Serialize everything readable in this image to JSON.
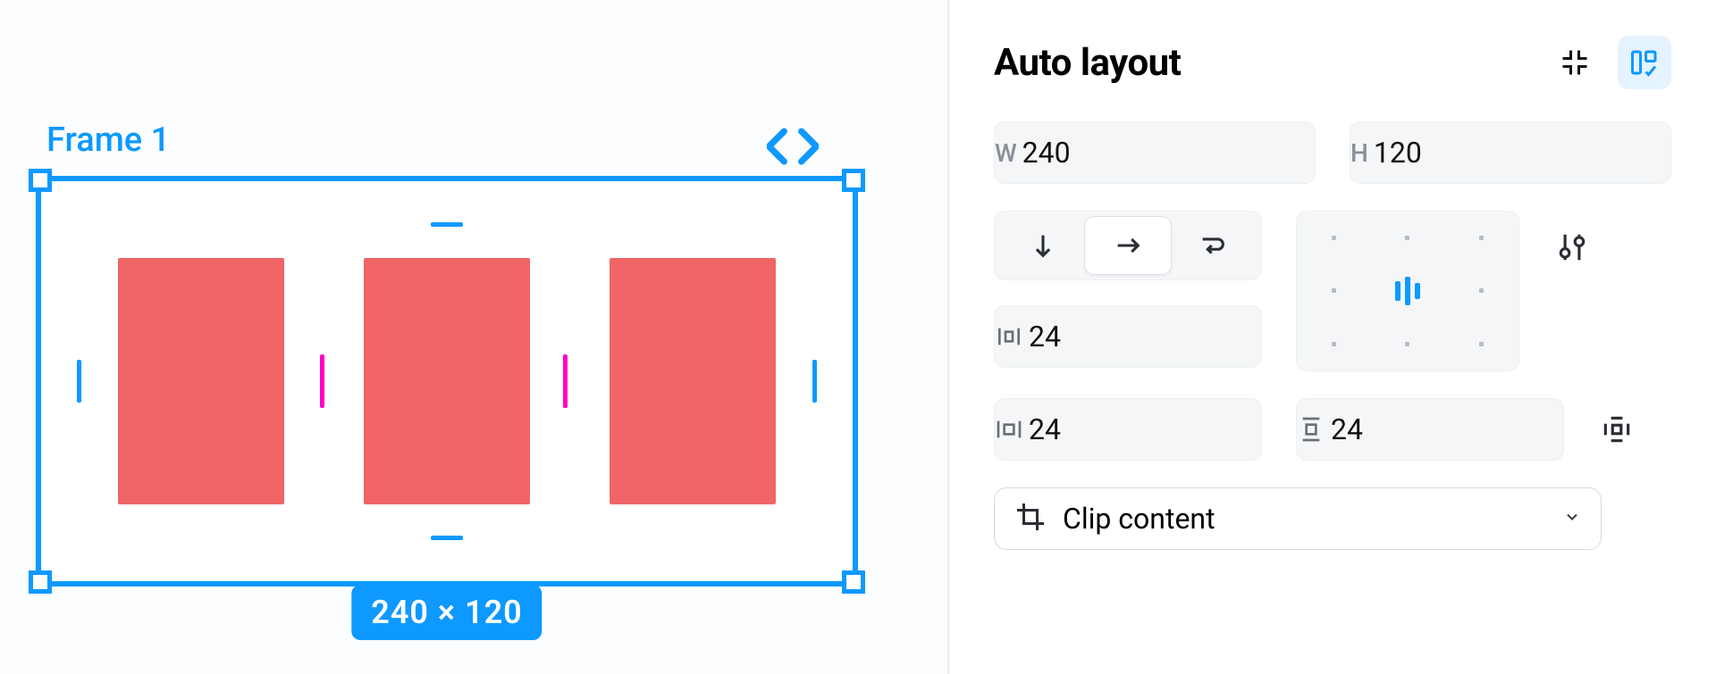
{
  "canvas": {
    "frame_label": "Frame 1",
    "dimensions_badge": "240 × 120"
  },
  "panel": {
    "title": "Auto layout",
    "width_prefix": "W",
    "height_prefix": "H",
    "width_value": "240",
    "height_value": "120",
    "gap_value": "24",
    "padding_h_value": "24",
    "padding_v_value": "24",
    "clip_label": "Clip content"
  }
}
